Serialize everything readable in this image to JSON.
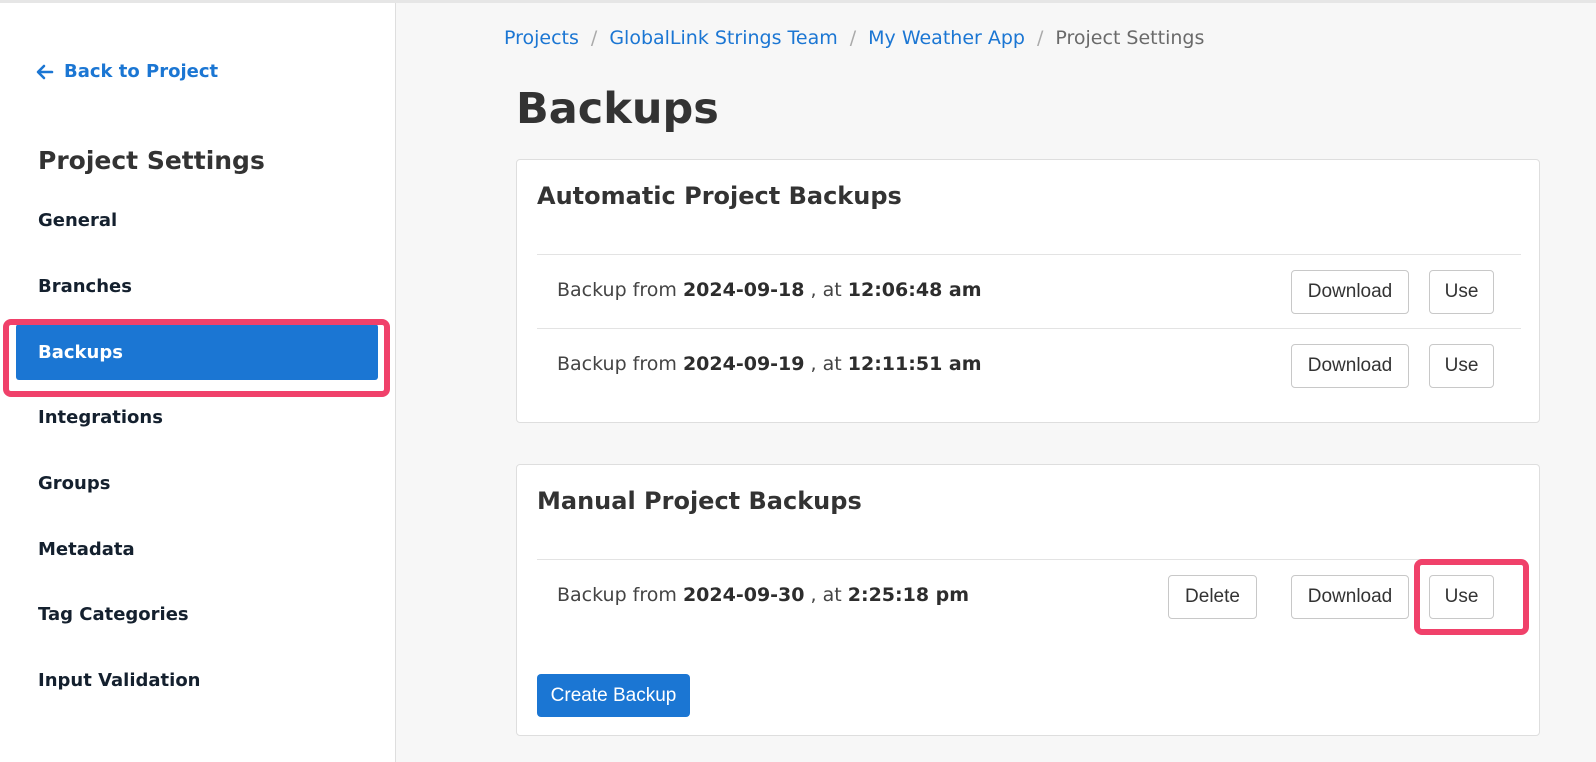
{
  "sidebar": {
    "back_label": "Back to Project",
    "title": "Project Settings",
    "items": [
      {
        "label": "General"
      },
      {
        "label": "Branches"
      },
      {
        "label": "Backups"
      },
      {
        "label": "Integrations"
      },
      {
        "label": "Groups"
      },
      {
        "label": "Metadata"
      },
      {
        "label": "Tag Categories"
      },
      {
        "label": "Input Validation"
      }
    ],
    "active_item": "Backups"
  },
  "breadcrumb": {
    "items": [
      "Projects",
      "GlobalLink Strings Team",
      "My Weather App"
    ],
    "current": "Project Settings",
    "separator": "/"
  },
  "page": {
    "title": "Backups"
  },
  "automatic": {
    "title": "Automatic Project Backups",
    "rows": [
      {
        "prefix": "Backup from",
        "date": "2024-09-18",
        "mid": ", at",
        "time": "12:06:48 am",
        "download_label": "Download",
        "use_label": "Use"
      },
      {
        "prefix": "Backup from",
        "date": "2024-09-19",
        "mid": ", at",
        "time": "12:11:51 am",
        "download_label": "Download",
        "use_label": "Use"
      }
    ]
  },
  "manual": {
    "title": "Manual Project Backups",
    "rows": [
      {
        "prefix": "Backup from",
        "date": "2024-09-30",
        "mid": ", at",
        "time": "2:25:18 pm",
        "delete_label": "Delete",
        "download_label": "Download",
        "use_label": "Use"
      }
    ],
    "create_label": "Create Backup"
  },
  "colors": {
    "accent": "#1b76d3",
    "highlight": "#f0416a"
  },
  "icons": {
    "back": "arrow-left-icon"
  }
}
